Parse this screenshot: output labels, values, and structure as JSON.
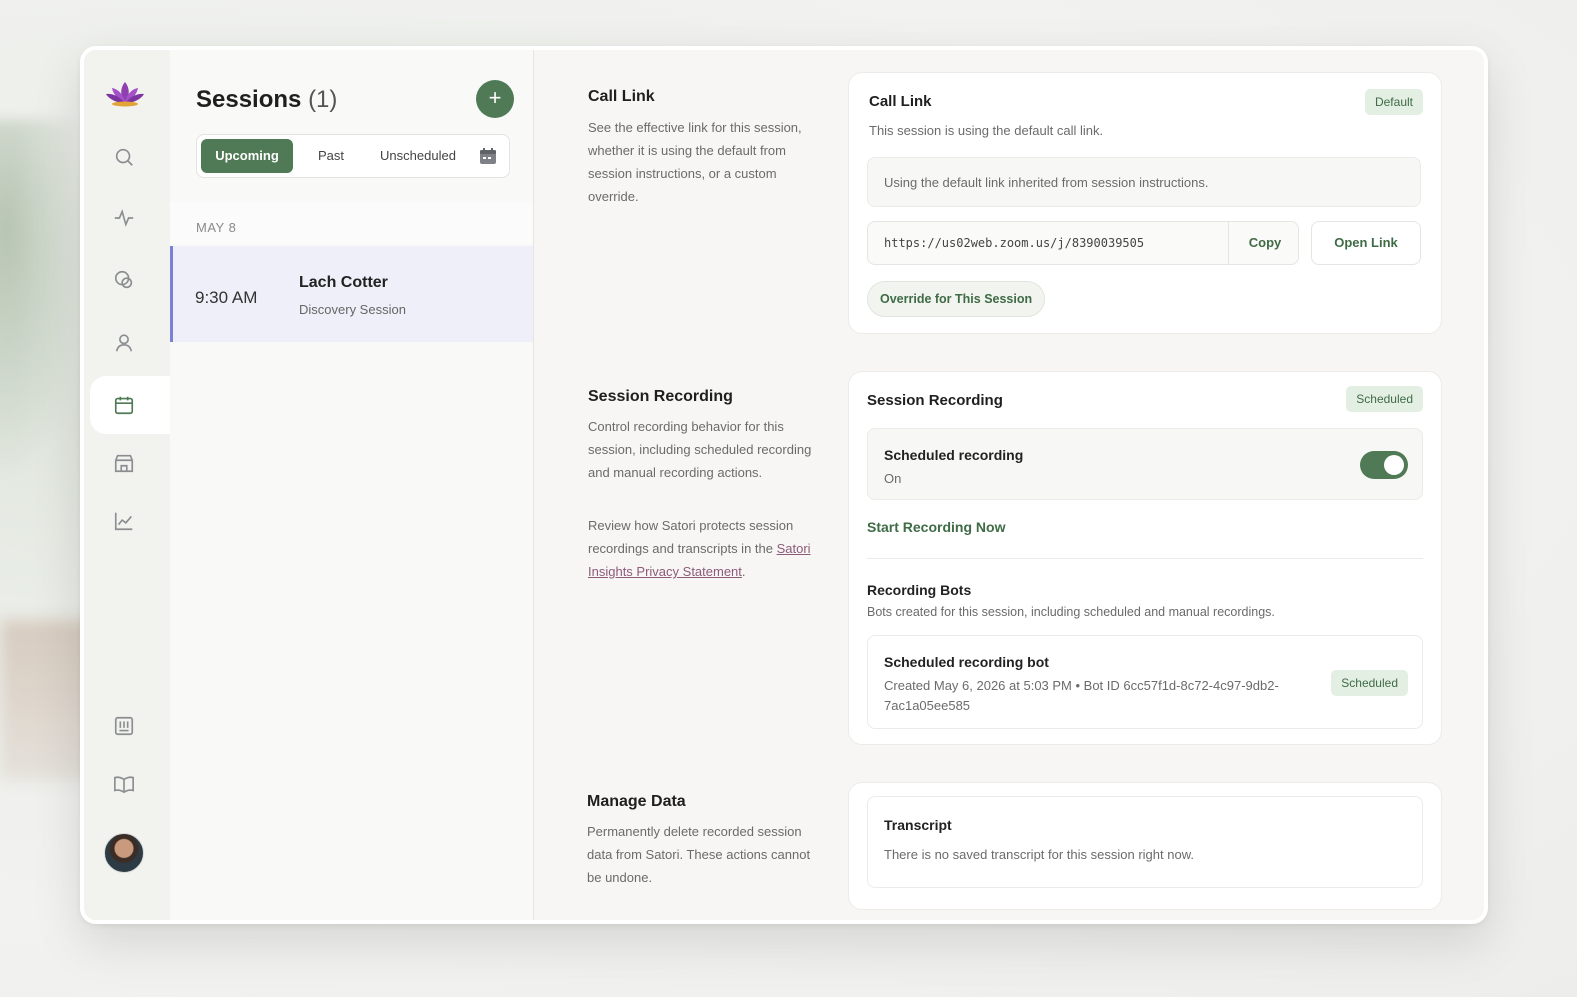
{
  "rail": {
    "icons": [
      "lotus-logo",
      "search-icon",
      "activity-icon",
      "chat-icon",
      "user-icon",
      "calendar-icon",
      "store-icon",
      "chart-icon",
      "journal-icon",
      "book-icon",
      "avatar"
    ]
  },
  "sessions": {
    "title": "Sessions",
    "count": "(1)",
    "tabs": [
      "Upcoming",
      "Past",
      "Unscheduled"
    ],
    "active_tab": "Upcoming",
    "date_group": "MAY 8",
    "items": [
      {
        "time": "9:30 AM",
        "name": "Lach Cotter",
        "type": "Discovery Session"
      }
    ]
  },
  "call_link": {
    "heading": "Call Link",
    "description": "See the effective link for this session, whether it is using the default from session instructions, or a custom override.",
    "card_title": "Call Link",
    "badge": "Default",
    "subtitle": "This session is using the default call link.",
    "info": "Using the default link inherited from session instructions.",
    "url": "https://us02web.zoom.us/j/8390039505",
    "copy_label": "Copy",
    "open_label": "Open Link",
    "override_label": "Override for This Session"
  },
  "recording": {
    "heading": "Session Recording",
    "description": "Control recording behavior for this session, including scheduled recording and manual recording actions.",
    "privacy_prefix": "Review how Satori protects session recordings and transcripts in the",
    "privacy_link": "Satori Insights Privacy Statement",
    "privacy_suffix": ".",
    "card_title": "Session Recording",
    "badge": "Scheduled",
    "scheduled_label": "Scheduled recording",
    "scheduled_state": "On",
    "toggle_on": true,
    "start_now": "Start Recording Now",
    "bots_title": "Recording Bots",
    "bots_desc": "Bots created for this session, including scheduled and manual recordings.",
    "bot": {
      "name": "Scheduled recording bot",
      "meta_line1": "Created May 6, 2026 at 5:03 PM • Bot ID 6cc57f1d-8c72-4c97-9db2-",
      "meta_line2": "7ac1a05ee585",
      "badge": "Scheduled"
    }
  },
  "manage": {
    "heading": "Manage Data",
    "description": "Permanently delete recorded session data from Satori. These actions cannot be undone.",
    "transcript_title": "Transcript",
    "transcript_desc": "There is no saved transcript for this session right now."
  },
  "colors": {
    "accent": "#4f7a55",
    "selection": "#eeeff9",
    "selection_border": "#7b7fd6",
    "link": "#8c5b78"
  }
}
